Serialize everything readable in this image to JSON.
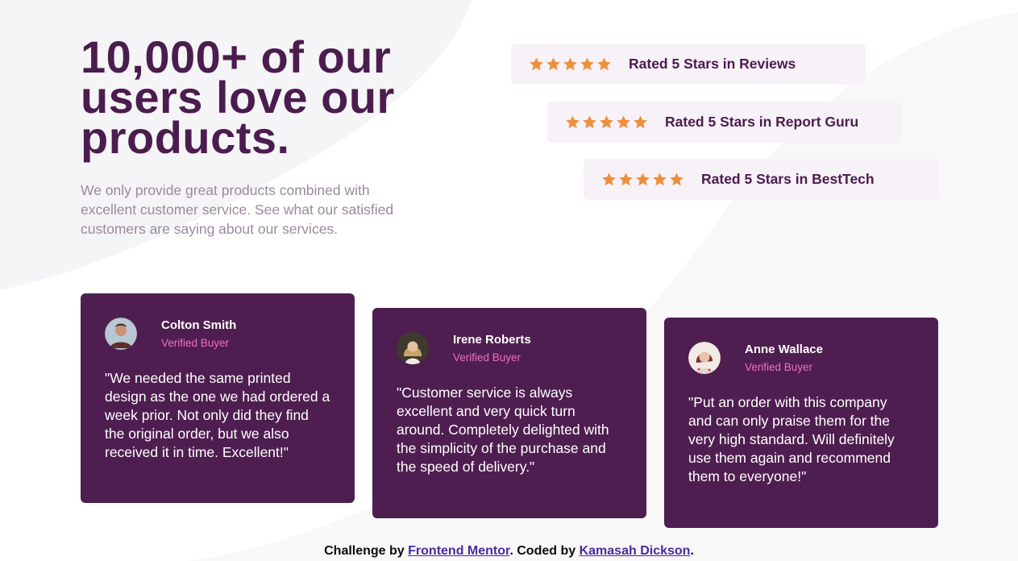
{
  "hero": {
    "title": "10,000+ of our users love our products.",
    "description": "We only provide great products combined with excellent customer service. See what our satisfied customers are saying about our services."
  },
  "ratings": [
    {
      "stars": 5,
      "label": "Rated 5 Stars in Reviews"
    },
    {
      "stars": 5,
      "label": "Rated 5 Stars in Report Guru"
    },
    {
      "stars": 5,
      "label": "Rated 5 Stars in BestTech"
    }
  ],
  "testimonials": [
    {
      "name": "Colton Smith",
      "role": "Verified Buyer",
      "quote": "\"We needed the same printed design as the one we had ordered a week prior. Not only did they find the original order, but we also received it in time. Excellent!\""
    },
    {
      "name": "Irene Roberts",
      "role": "Verified Buyer",
      "quote": "\"Customer service is always excellent and very quick turn around. Completely delighted with the simplicity of the purchase and the speed of delivery.\""
    },
    {
      "name": "Anne Wallace",
      "role": "Verified Buyer",
      "quote": "\"Put an order with this company and can only praise them for the very high standard. Will definitely use them again and recommend them to everyone!\""
    }
  ],
  "footer": {
    "prefix": "Challenge by ",
    "link1": "Frontend Mentor",
    "middle": ". Coded by ",
    "link2": "Kamasah Dickson",
    "suffix": "."
  },
  "colors": {
    "primary": "#4b1c4e",
    "card": "#4f1e50",
    "rating_bg": "#f7f1f8",
    "star": "#ee8f3d",
    "accent": "#ee6ebd"
  },
  "icons": {
    "star": "star-icon",
    "avatar": "avatar-icon"
  }
}
